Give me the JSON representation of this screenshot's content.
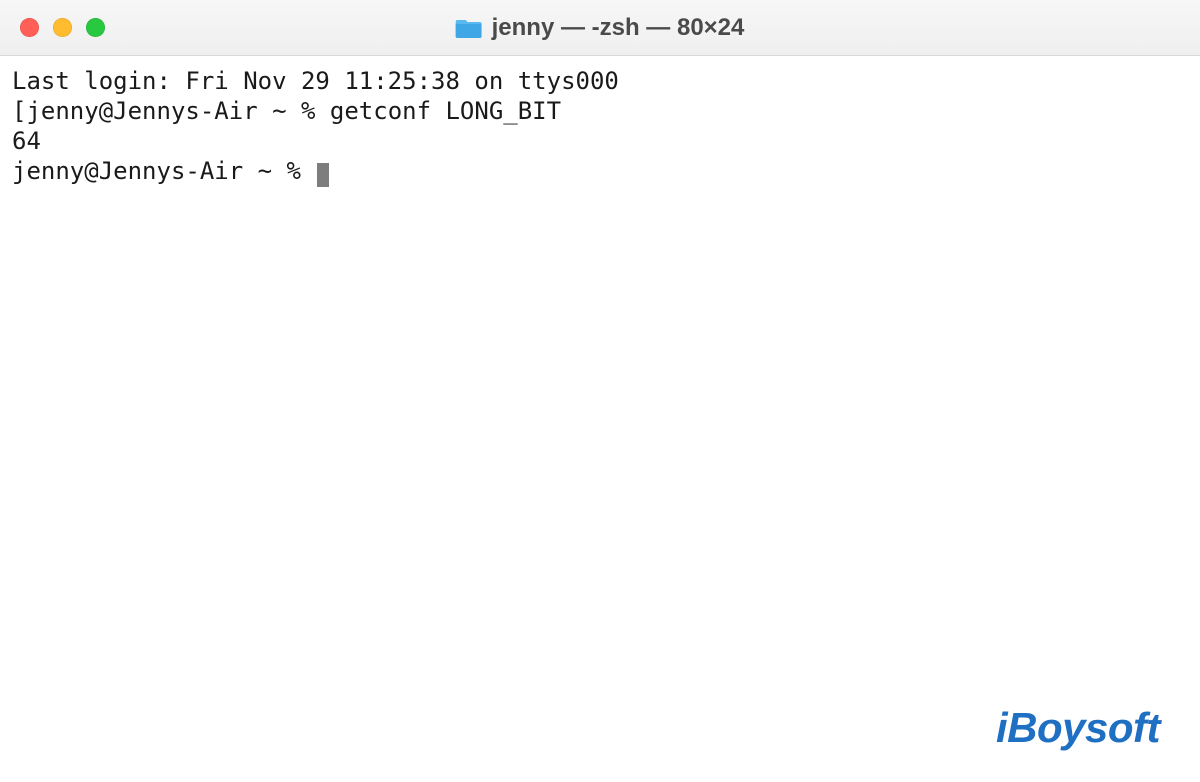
{
  "window": {
    "title": "jenny — -zsh — 80×24",
    "icon": "folder-icon"
  },
  "terminal": {
    "last_login": "Last login: Fri Nov 29 11:25:38 on ttys000",
    "line1_prompt": "[jenny@Jennys-Air ~ % ",
    "line1_command": "getconf LONG_BIT",
    "output": "64",
    "line2_prompt": "jenny@Jennys-Air ~ % "
  },
  "watermark": "iBoysoft"
}
